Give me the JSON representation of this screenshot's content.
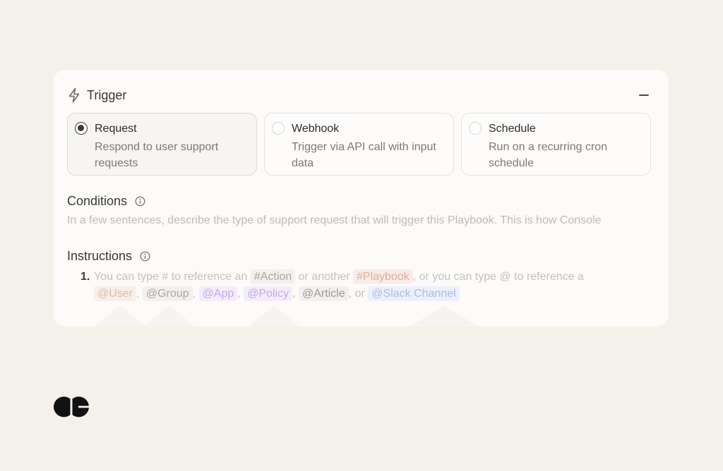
{
  "trigger": {
    "title": "Trigger",
    "icons": {
      "bolt": "lightning-icon",
      "collapse": "minus-icon"
    }
  },
  "options": [
    {
      "label": "Request",
      "description": "Respond to user support requests",
      "selected": true
    },
    {
      "label": "Webhook",
      "description": "Trigger via API call with input data",
      "selected": false
    },
    {
      "label": "Schedule",
      "description": "Run on a recurring cron schedule",
      "selected": false
    }
  ],
  "conditions": {
    "title": "Conditions",
    "placeholder": "In a few sentences, describe the type of support request that will trigger this Playbook. This is how Console"
  },
  "instructions": {
    "title": "Instructions",
    "number": "1.",
    "t1": "You can type # to reference an",
    "chip_action": "#Action",
    "t2": "or another",
    "chip_playbook": "#Playbook",
    "t3": ", or you can type @ to reference a",
    "chip_user": "@User",
    "sep": ",",
    "chip_group": "@Group",
    "chip_app": "@App",
    "chip_policy": "@Policy",
    "chip_article": "@Article",
    "or": ", or",
    "chip_slack": "@Slack Channel"
  },
  "colors": {
    "background": "#f4f1eb",
    "card": "#fcfbf9",
    "playbook": "#dcae9c",
    "app": "#c5a7eb",
    "slack": "#a9bce8"
  },
  "logo": {
    "icon": "console-logo"
  }
}
